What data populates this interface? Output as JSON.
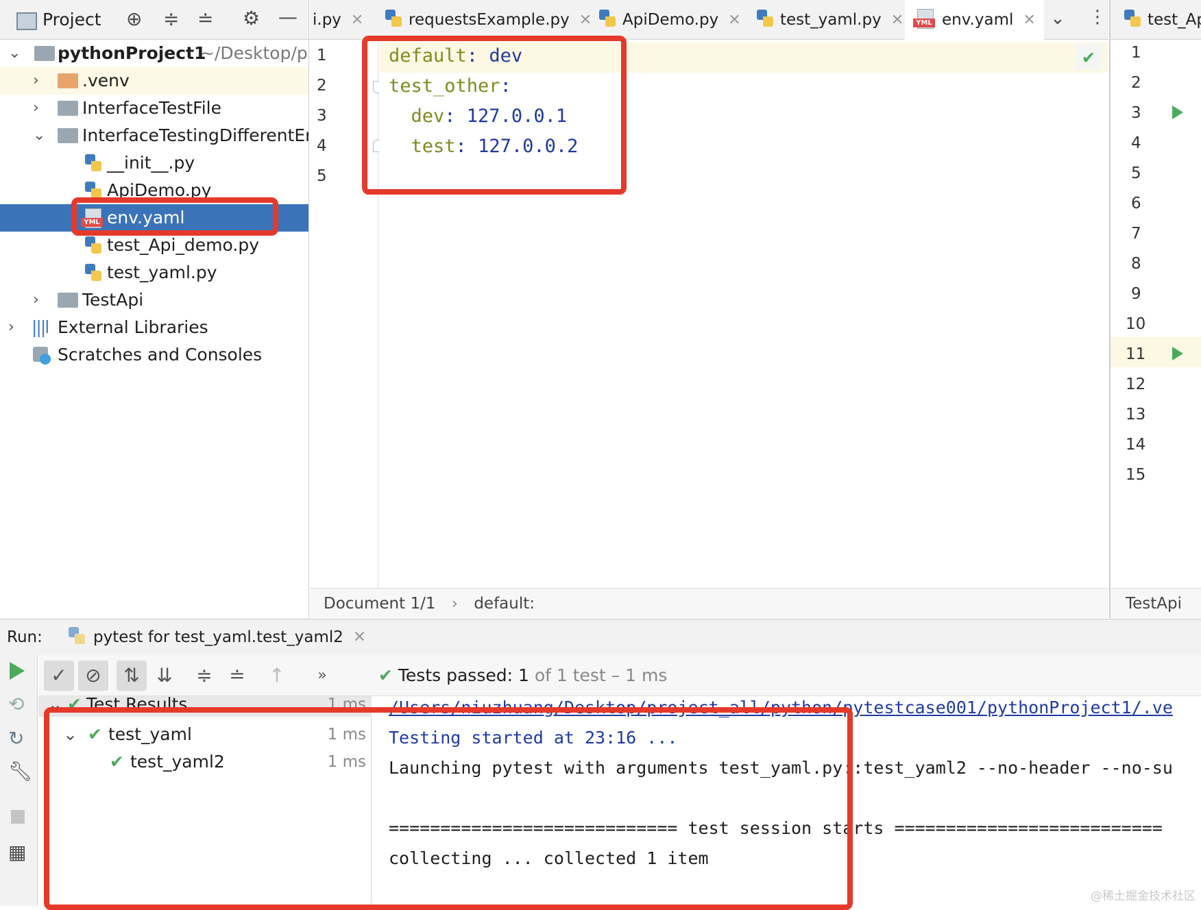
{
  "project": {
    "title": "Project",
    "tree": [
      {
        "label": "pythonProject1",
        "suffix": "~/Desktop/pr"
      },
      {
        "label": ".venv"
      },
      {
        "label": "InterfaceTestFile"
      },
      {
        "label": "InterfaceTestingDifferentEn"
      },
      {
        "label": "__init__.py"
      },
      {
        "label": "ApiDemo.py"
      },
      {
        "label": "env.yaml"
      },
      {
        "label": "test_Api_demo.py"
      },
      {
        "label": "test_yaml.py"
      },
      {
        "label": "TestApi"
      },
      {
        "label": "External Libraries"
      },
      {
        "label": "Scratches and Consoles"
      }
    ]
  },
  "editor": {
    "tabs": [
      "i.py",
      "requestsExample.py",
      "ApiDemo.py",
      "test_yaml.py",
      "env.yaml"
    ],
    "active_tab": "env.yaml",
    "line_numbers": [
      "1",
      "2",
      "3",
      "4",
      "5"
    ],
    "code": [
      {
        "key": "default",
        "sep": ": ",
        "val": "dev"
      },
      {
        "key": "test_other",
        "sep": ":",
        "val": ""
      },
      {
        "key": "  dev",
        "sep": ": ",
        "val": "127.0.0.1"
      },
      {
        "key": "  test",
        "sep": ": ",
        "val": "127.0.0.2"
      }
    ],
    "breadcrumb": [
      "Document 1/1",
      "default:"
    ]
  },
  "right_pane": {
    "tab": "test_Api",
    "line_numbers": [
      "1",
      "2",
      "3",
      "4",
      "5",
      "6",
      "7",
      "8",
      "9",
      "10",
      "11",
      "12",
      "13",
      "14",
      "15"
    ],
    "breadcrumb": "TestApi"
  },
  "run": {
    "label": "Run:",
    "tab": "pytest for test_yaml.test_yaml2",
    "status_prefix": "Tests passed:",
    "status_count": "1",
    "status_suffix": "of 1 test – 1 ms",
    "tree": [
      {
        "label": "Test Results",
        "time": "1 ms"
      },
      {
        "label": "test_yaml",
        "time": "1 ms"
      },
      {
        "label": "test_yaml2",
        "time": "1 ms"
      }
    ],
    "console": [
      "/Users/niuzhuang/Desktop/project_all/python/pytestcase001/pythonProject1/.ve",
      "Testing started at 23:16 ...",
      "Launching pytest with arguments test_yaml.py::test_yaml2 --no-header --no-su",
      "",
      "============================ test session starts ==========================",
      "collecting ... collected 1 item"
    ]
  },
  "watermark": "@稀土掘金技术社区"
}
